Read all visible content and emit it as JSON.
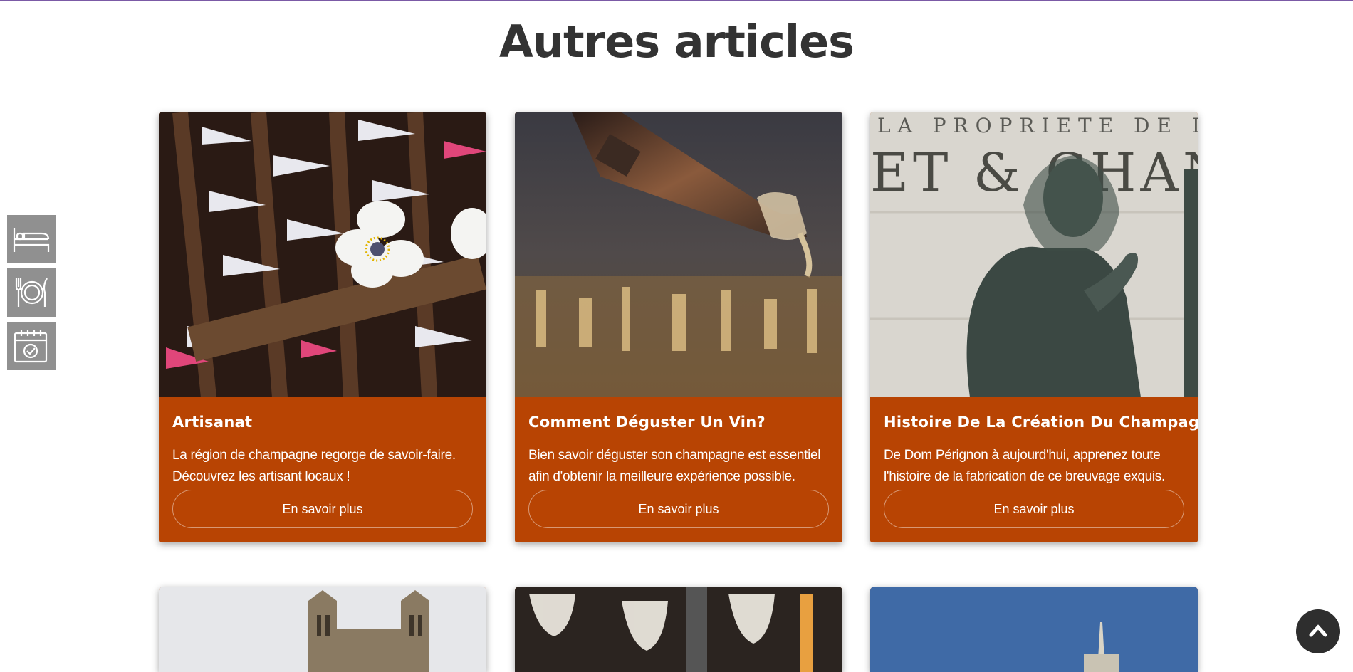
{
  "page": {
    "title": "Autres articles"
  },
  "side_nav": [
    {
      "icon": "bed-icon"
    },
    {
      "icon": "plate-fork-knife-icon"
    },
    {
      "icon": "calendar-check-icon"
    }
  ],
  "articles": [
    {
      "title": "Artisanat",
      "description": "La région de champagne regorge de savoir-faire. Découvrez les artisant locaux !",
      "cta": "En savoir plus"
    },
    {
      "title": "Comment Déguster Un Vin?",
      "description": "Bien savoir déguster son champagne est essentiel afin d'obtenir la meilleure expérience possible.",
      "cta": "En savoir plus"
    },
    {
      "title": "Histoire De La Création Du Champagne",
      "description": "De Dom Pérignon à aujourd'hui, apprenez toute l'histoire de la fabrication de ce breuvage exquis.",
      "cta": "En savoir plus"
    }
  ],
  "statue_inscription": [
    "LA PROPRIETE DE L",
    "ET & CHAN"
  ],
  "scroll_top": {
    "icon": "chevron-up-icon"
  },
  "colors": {
    "card": "#b84403",
    "side_button": "#909090",
    "title": "#333333"
  }
}
